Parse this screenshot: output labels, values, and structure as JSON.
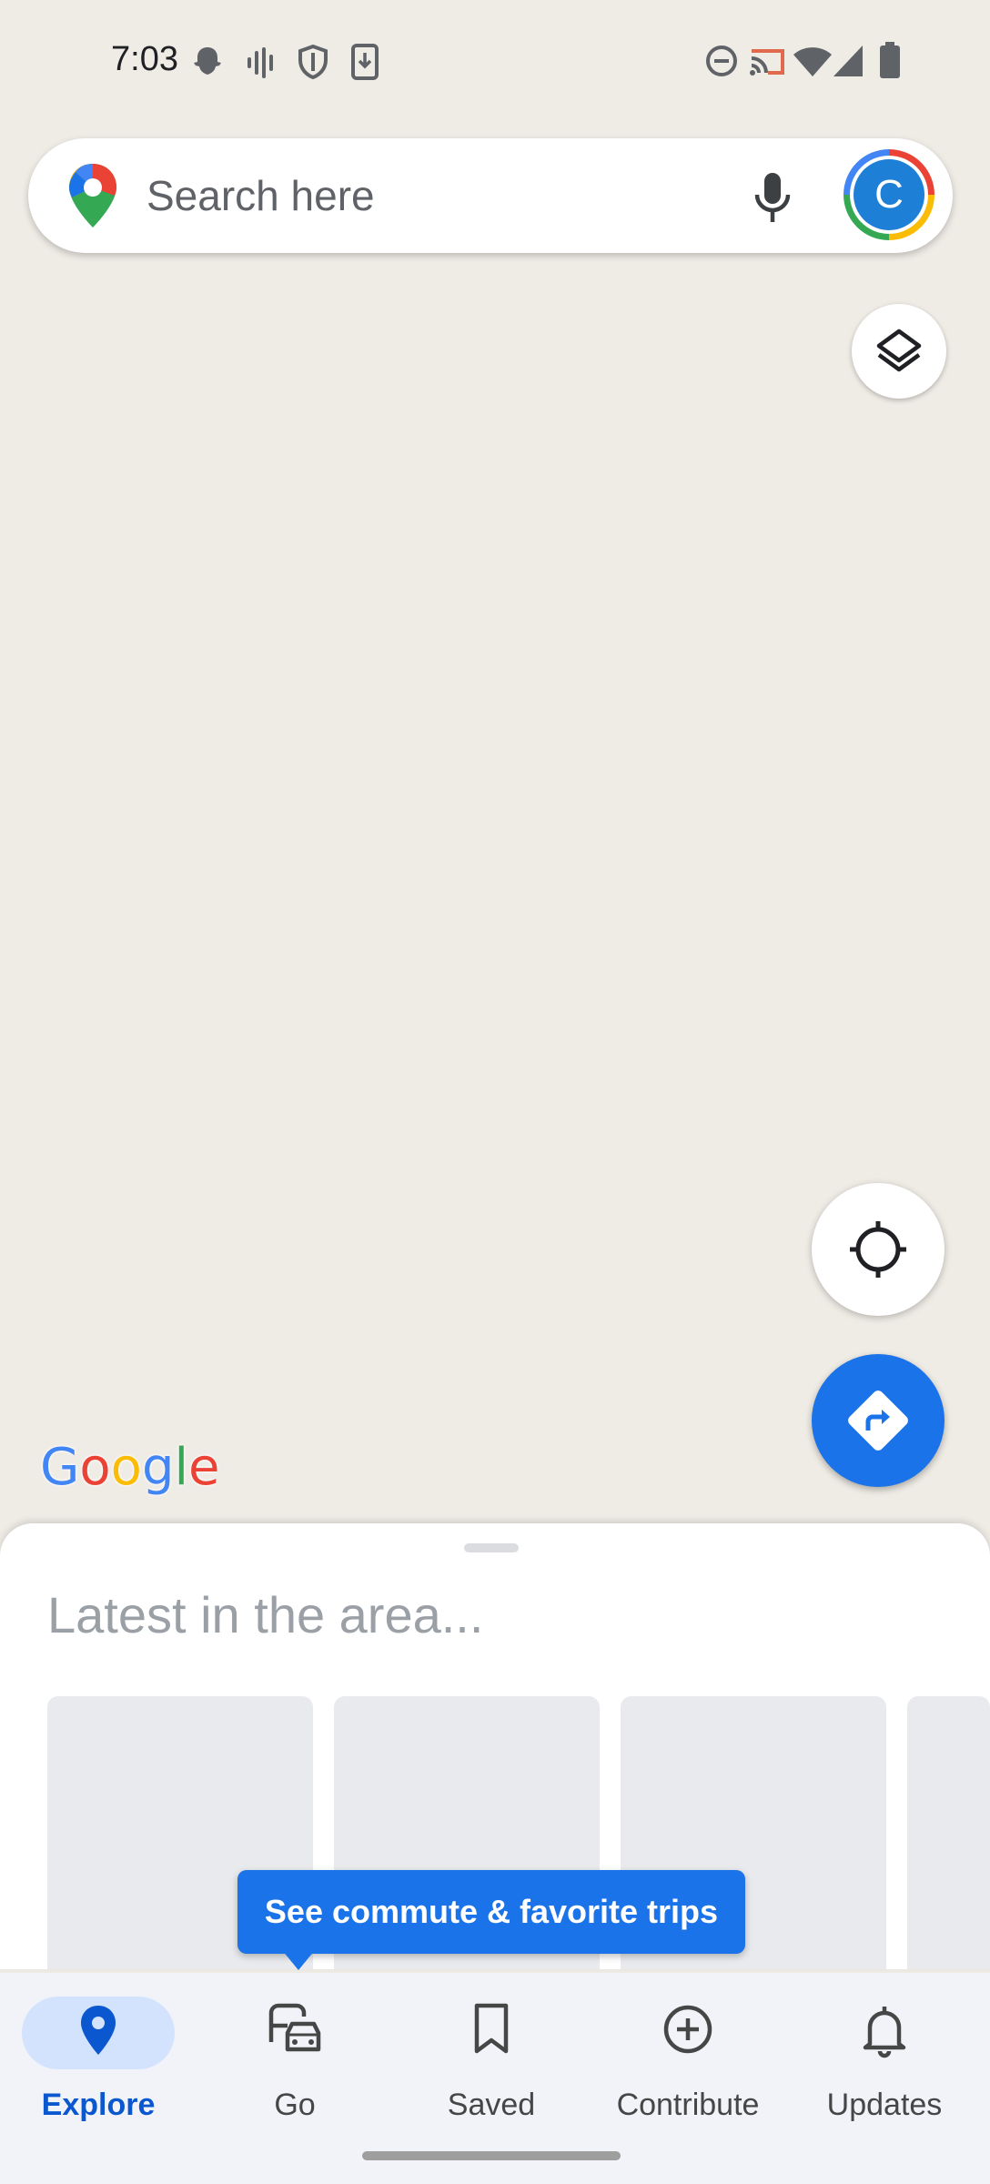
{
  "status_bar": {
    "time": "7:03",
    "icons": [
      "snapchat-icon",
      "voicemail-icon",
      "shield-icon",
      "download-icon",
      "dnd-icon",
      "cast-icon",
      "wifi-icon",
      "signal-icon",
      "battery-icon"
    ]
  },
  "search": {
    "placeholder": "Search here",
    "avatar_letter": "C"
  },
  "map": {
    "background": "#efebe5",
    "logo_letters": [
      "G",
      "o",
      "o",
      "g",
      "l",
      "e"
    ]
  },
  "sheet": {
    "title": "Latest in the area..."
  },
  "tooltip": {
    "text": "See commute & favorite trips"
  },
  "nav": {
    "items": [
      {
        "label": "Explore",
        "icon": "place-pin-icon",
        "active": true
      },
      {
        "label": "Go",
        "icon": "commute-icon",
        "active": false
      },
      {
        "label": "Saved",
        "icon": "bookmark-icon",
        "active": false
      },
      {
        "label": "Contribute",
        "icon": "add-circle-icon",
        "active": false
      },
      {
        "label": "Updates",
        "icon": "bell-icon",
        "active": false
      }
    ]
  },
  "colors": {
    "accent": "#1a73e8",
    "active_pill": "#d3e3fd",
    "active_label": "#0b57d0",
    "nav_background": "#f1f3f9"
  }
}
